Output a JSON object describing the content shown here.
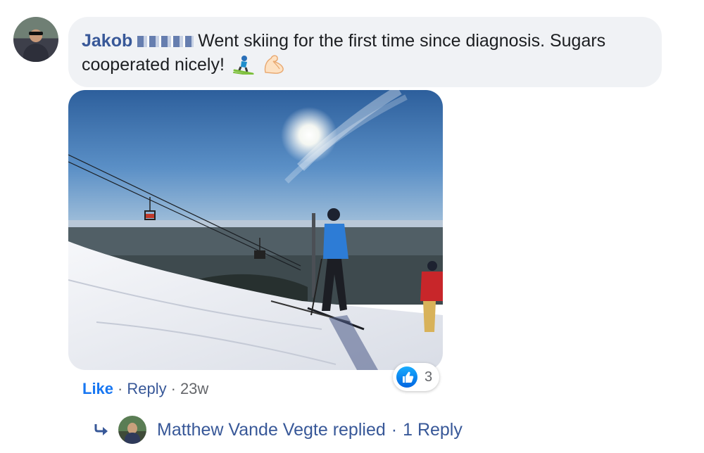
{
  "comment": {
    "author": "Jakob",
    "text": "Went skiing for the first time since diagnosis. Sugars cooperated nicely!",
    "emojis": [
      "skier-emoji",
      "flexed-biceps-emoji"
    ]
  },
  "reactions": {
    "icon": "like-icon",
    "count": "3"
  },
  "actions": {
    "like": "Like",
    "reply": "Reply",
    "separator": "·",
    "time": "23w"
  },
  "replies": {
    "text": "Matthew Vande Vegte replied",
    "separator": "·",
    "count": "1 Reply"
  },
  "colors": {
    "bubble": "#f0f2f5",
    "link": "#385898",
    "like": "#1877f2",
    "meta": "#65676b"
  }
}
